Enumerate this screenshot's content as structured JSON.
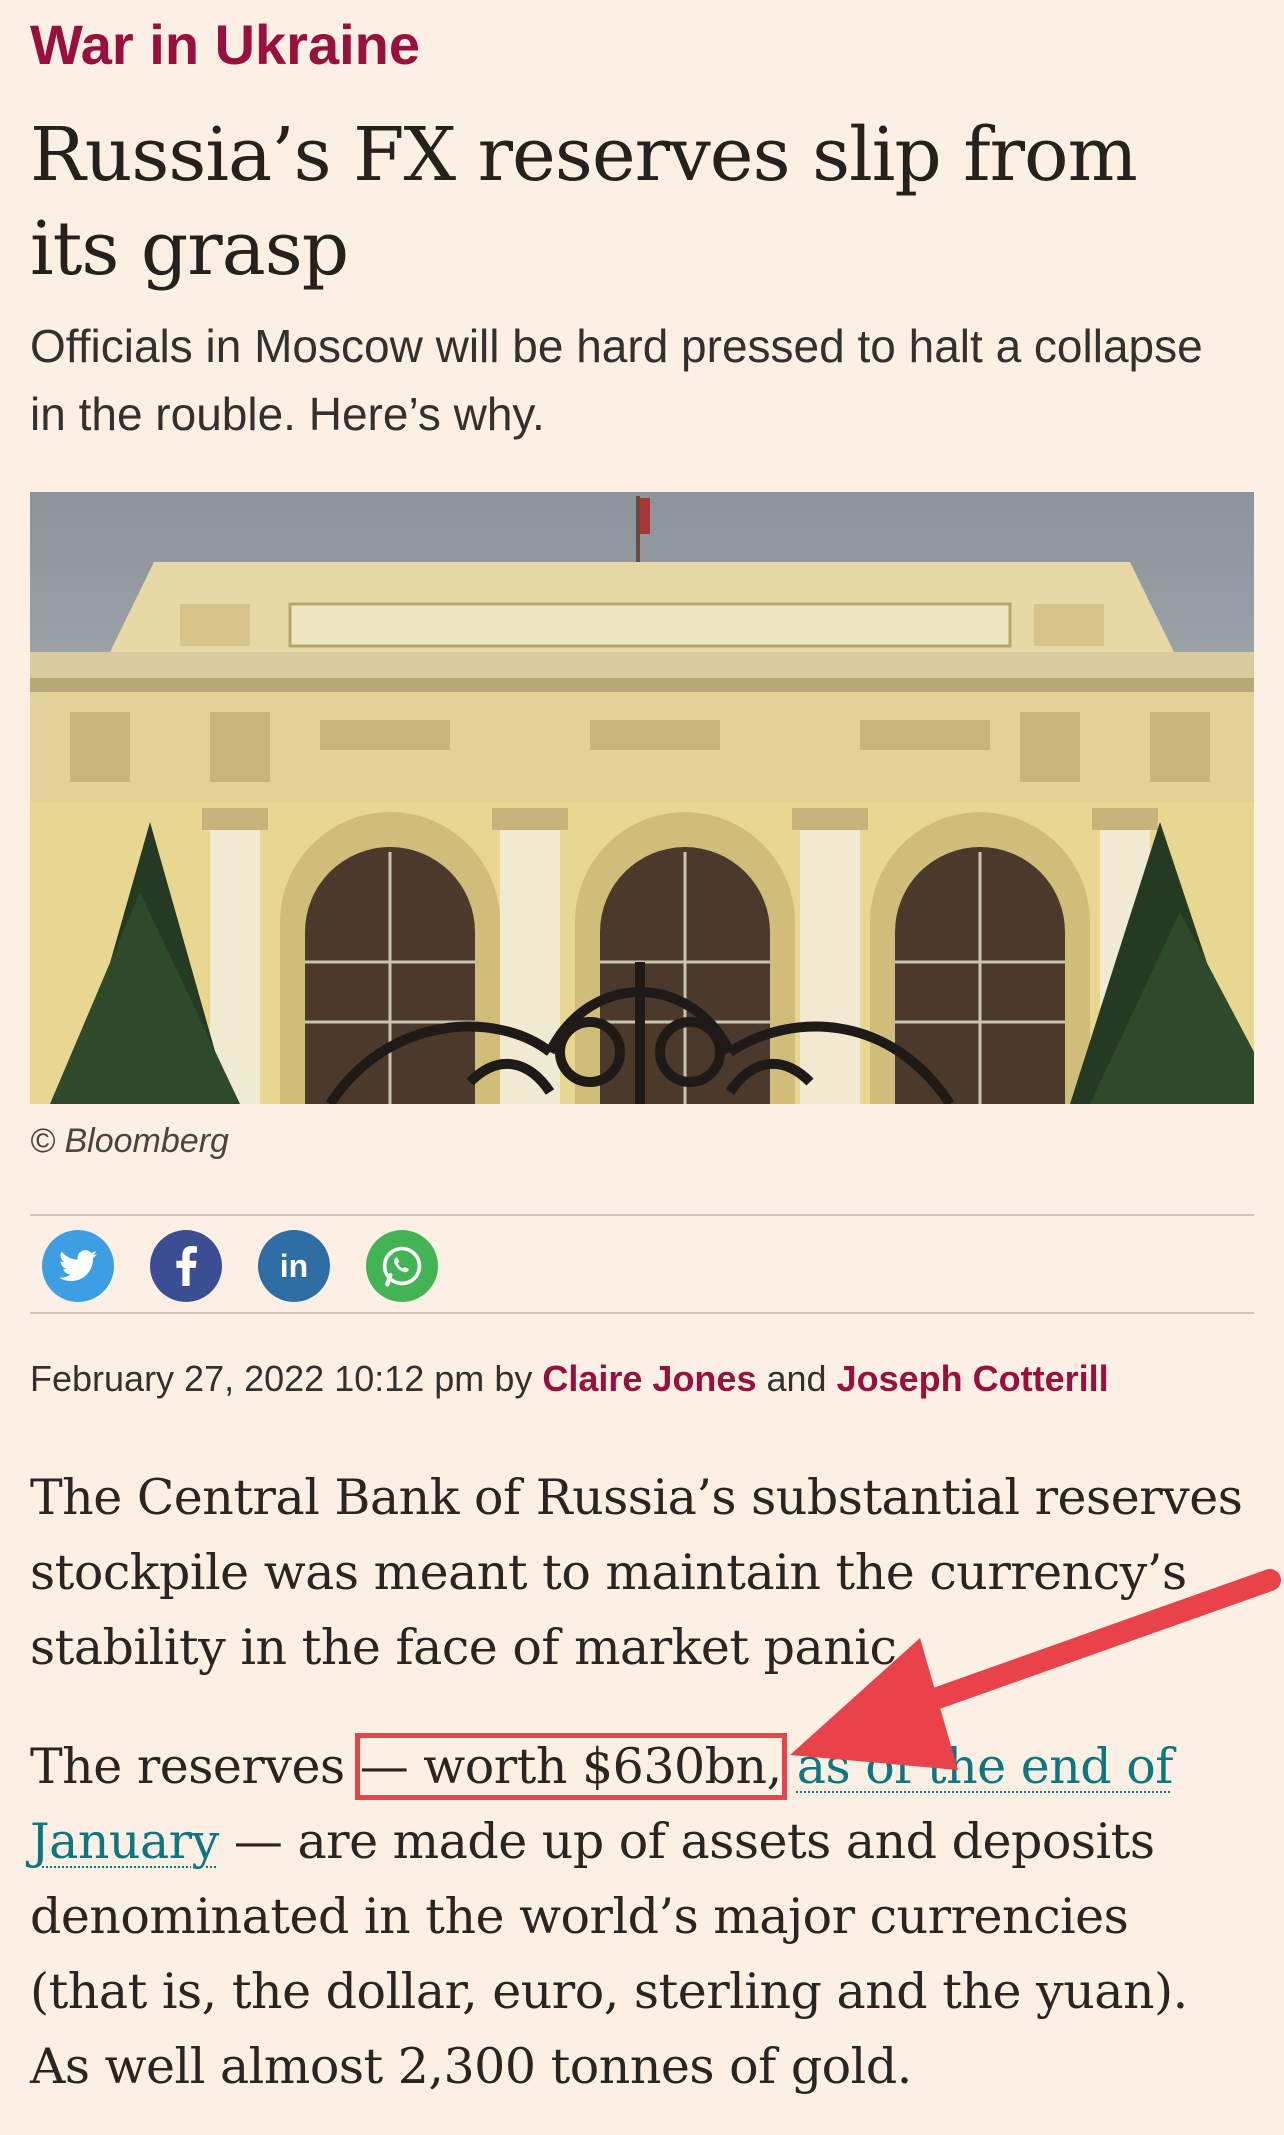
{
  "article": {
    "section": "War in Ukraine",
    "headline": "Russia’s FX reserves slip from its grasp",
    "standfirst": "Officials in Moscow will be hard pressed to halt a collapse in the rouble. Here’s why.",
    "image_caption": "© Bloomberg",
    "byline": {
      "date": "February 27, 2022 10:12 pm",
      "by": "by",
      "author1": "Claire Jones",
      "and": "and",
      "author2": "Joseph Cotterill"
    },
    "paragraph1": "The Central Bank of Russia’s substantial reserves stockpile was meant to maintain the currency’s stability in the face of market panic.",
    "paragraph2": {
      "before": "The reserves ",
      "highlight": "— worth $630bn,",
      "link": "as of the end of January",
      "after": " — are made up of assets and deposits denominated in the world’s major currencies (that is, the dollar, euro, sterling and the yuan). As well almost 2,300 tonnes of gold."
    }
  },
  "share": [
    {
      "name": "twitter",
      "color": "#3d9ee3"
    },
    {
      "name": "facebook",
      "color": "#3b4e93"
    },
    {
      "name": "linkedin",
      "color": "#2f6ea5"
    },
    {
      "name": "whatsapp",
      "color": "#42b454"
    }
  ],
  "annotation": {
    "color": "#e8434b"
  }
}
